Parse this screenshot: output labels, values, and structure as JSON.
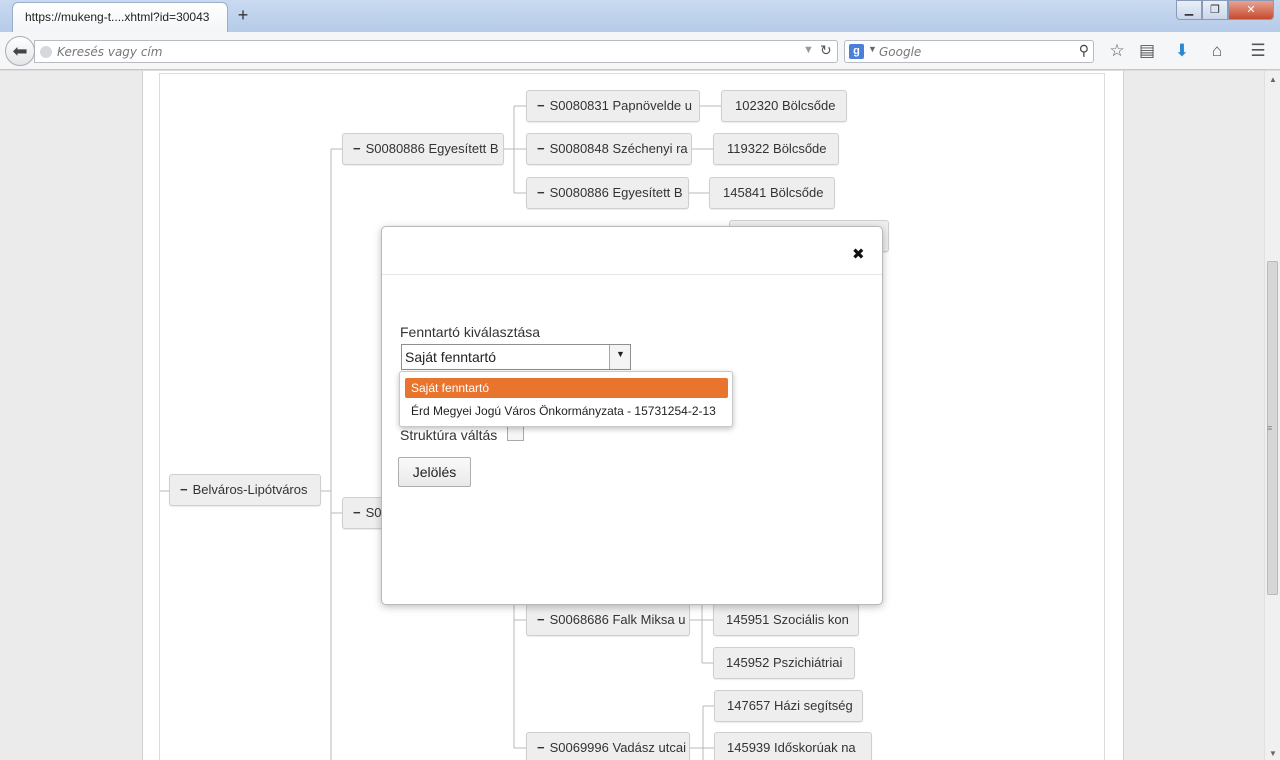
{
  "browser": {
    "tab_title": "https://mukeng-t....xhtml?id=30043",
    "new_tab": "+",
    "window_min": "▁",
    "window_max": "❐",
    "window_close": "✕",
    "url_placeholder": "Keresés vagy cím",
    "search_engine": "g",
    "search_placeholder": "Google"
  },
  "tree": {
    "root": "Belváros-Lipótváros",
    "toggle_symbol": "−",
    "level1": [
      {
        "label": "S0080886 Egyesített B"
      },
      {
        "label": "S00"
      }
    ],
    "level2": [
      {
        "label": "S0080831 Papnövelde u"
      },
      {
        "label": "S0080848 Széchenyi ra"
      },
      {
        "label": "S0080886 Egyesített B"
      },
      {
        "label": "S0068686 Falk Miksa u"
      },
      {
        "label": "S0069996 Vadász utcai"
      }
    ],
    "level3": [
      {
        "label": "102320 Bölcsőde"
      },
      {
        "label": "119322 Bölcsőde"
      },
      {
        "label": "145841 Bölcsőde"
      },
      {
        "label": ""
      },
      {
        "label": "145951 Szociális kon"
      },
      {
        "label": "145952 Pszichiátriai"
      },
      {
        "label": "147657 Házi segítség"
      },
      {
        "label": "145939 Időskorúak na"
      }
    ]
  },
  "modal": {
    "close": "✖",
    "fenntarto_label": "Fenntartó kiválasztása",
    "fenntarto_selected": "Saját fenntartó",
    "fenntarto_options": [
      "Saját fenntartó",
      "Érd Megyei Jogú Város Önkormányzata - 15731254-2-13"
    ],
    "struktura_label": "Struktúra váltás",
    "jeloles_button": "Jelölés"
  },
  "colors": {
    "selected_option": "#e8742e",
    "node_bg": "#eeeeee",
    "tree_line": "#b9b9b9"
  }
}
